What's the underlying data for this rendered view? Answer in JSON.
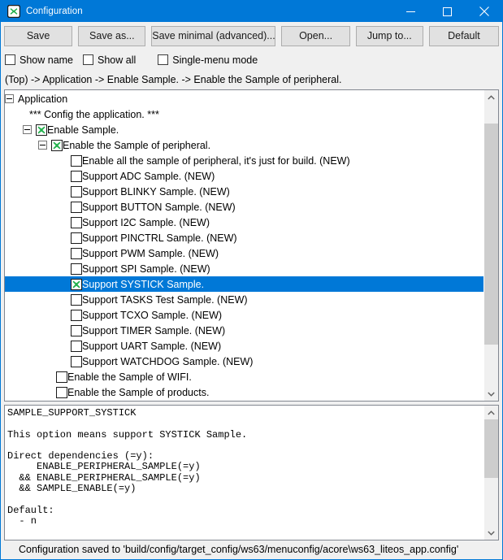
{
  "window": {
    "title": "Configuration",
    "icon": "green-x-icon",
    "accent_color": "#0078d7",
    "controls": {
      "minimize": "minimize-icon",
      "maximize": "maximize-icon",
      "close": "close-icon"
    }
  },
  "toolbar": {
    "buttons": [
      {
        "label": "Save",
        "name": "save-button"
      },
      {
        "label": "Save as...",
        "name": "save-as-button"
      },
      {
        "label": "Save minimal (advanced)...",
        "name": "save-minimal-button"
      },
      {
        "label": "Open...",
        "name": "open-button"
      },
      {
        "label": "Jump to...",
        "name": "jump-to-button"
      },
      {
        "label": "Default",
        "name": "default-button"
      }
    ]
  },
  "options": {
    "show_name": {
      "label": "Show name",
      "checked": false
    },
    "show_all": {
      "label": "Show all",
      "checked": false
    },
    "single_menu_mode": {
      "label": "Single-menu mode",
      "checked": false
    }
  },
  "breadcrumb": "(Top) -> Application -> Enable Sample. -> Enable the Sample of peripheral.",
  "tree": {
    "rows": [
      {
        "indent": 0,
        "expander": "collapse",
        "checkbox": "none",
        "label": "Application",
        "selected": false
      },
      {
        "indent": 30,
        "expander": "none",
        "checkbox": "none",
        "label": "*** Config the application. ***",
        "selected": false
      },
      {
        "indent": 22,
        "expander": "collapse",
        "checkbox": "checked",
        "label": "Enable Sample.",
        "selected": false
      },
      {
        "indent": 41,
        "expander": "collapse",
        "checkbox": "checked",
        "label": "Enable the Sample of peripheral.",
        "selected": false
      },
      {
        "indent": 81,
        "expander": "none",
        "checkbox": "empty",
        "label": "Enable all the sample of peripheral, it's just for build. (NEW)",
        "selected": false
      },
      {
        "indent": 81,
        "expander": "none",
        "checkbox": "empty",
        "label": "Support ADC Sample. (NEW)",
        "selected": false
      },
      {
        "indent": 81,
        "expander": "none",
        "checkbox": "empty",
        "label": "Support BLINKY Sample. (NEW)",
        "selected": false
      },
      {
        "indent": 81,
        "expander": "none",
        "checkbox": "empty",
        "label": "Support BUTTON Sample. (NEW)",
        "selected": false
      },
      {
        "indent": 81,
        "expander": "none",
        "checkbox": "empty",
        "label": "Support I2C Sample. (NEW)",
        "selected": false
      },
      {
        "indent": 81,
        "expander": "none",
        "checkbox": "empty",
        "label": "Support PINCTRL Sample. (NEW)",
        "selected": false
      },
      {
        "indent": 81,
        "expander": "none",
        "checkbox": "empty",
        "label": "Support PWM Sample. (NEW)",
        "selected": false
      },
      {
        "indent": 81,
        "expander": "none",
        "checkbox": "empty",
        "label": "Support SPI Sample. (NEW)",
        "selected": false
      },
      {
        "indent": 81,
        "expander": "none",
        "checkbox": "checked",
        "label": "Support SYSTICK Sample.",
        "selected": true
      },
      {
        "indent": 81,
        "expander": "none",
        "checkbox": "empty",
        "label": "Support TASKS Test Sample. (NEW)",
        "selected": false
      },
      {
        "indent": 81,
        "expander": "none",
        "checkbox": "empty",
        "label": "Support TCXO Sample. (NEW)",
        "selected": false
      },
      {
        "indent": 81,
        "expander": "none",
        "checkbox": "empty",
        "label": "Support TIMER Sample. (NEW)",
        "selected": false
      },
      {
        "indent": 81,
        "expander": "none",
        "checkbox": "empty",
        "label": "Support UART Sample. (NEW)",
        "selected": false
      },
      {
        "indent": 81,
        "expander": "none",
        "checkbox": "empty",
        "label": "Support WATCHDOG Sample. (NEW)",
        "selected": false
      },
      {
        "indent": 63,
        "expander": "none",
        "checkbox": "empty",
        "label": "Enable the Sample of WIFI.",
        "selected": false
      },
      {
        "indent": 63,
        "expander": "none",
        "checkbox": "empty",
        "label": "Enable the Sample of products.",
        "selected": false
      }
    ],
    "scrollbar": {
      "up_icon": "chevron-up-icon",
      "down_icon": "chevron-down-icon",
      "thumb_top_pct": 7,
      "thumb_height_pct": 78
    }
  },
  "help": {
    "text": "SAMPLE_SUPPORT_SYSTICK\n\nThis option means support SYSTICK Sample.\n\nDirect dependencies (=y):\n     ENABLE_PERIPHERAL_SAMPLE(=y)\n  && ENABLE_PERIPHERAL_SAMPLE(=y)\n  && SAMPLE_ENABLE(=y)\n\nDefault:\n  - n",
    "scrollbar": {
      "up_icon": "chevron-up-icon",
      "down_icon": "chevron-down-icon",
      "thumb_top_pct": 0,
      "thumb_height_pct": 55
    }
  },
  "status": {
    "message": "Configuration saved to 'build/config/target_config/ws63/menuconfig/acore\\ws63_liteos_app.config'"
  }
}
